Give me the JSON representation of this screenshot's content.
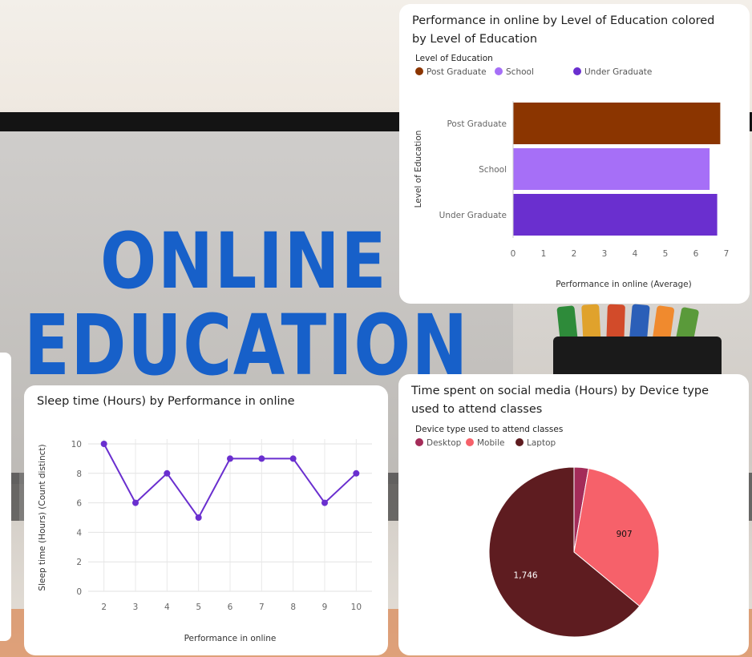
{
  "colors": {
    "post_graduate": "#8b3500",
    "school": "#a66ff7",
    "under_graduate": "#6a2fcf",
    "line": "#6a2fcf",
    "desktop": "#a42c59",
    "mobile": "#f6616a",
    "laptop": "#5e1c20"
  },
  "background": {
    "line1": "ONLINE",
    "line2": "EDUCATION"
  },
  "chart_data": [
    {
      "type": "bar",
      "orientation": "horizontal",
      "title": "Performance in online by Level of Education colored by Level of Education",
      "legend_title": "Level of Education",
      "legend_placement": "top-left",
      "categories": [
        "Post Graduate",
        "School",
        "Under Graduate"
      ],
      "values": [
        6.8,
        6.45,
        6.7
      ],
      "xlabel": "Performance in online (Average)",
      "ylabel": "Level of Education",
      "xlim": [
        0,
        7
      ],
      "xticks": [
        "0",
        "1",
        "2",
        "3",
        "4",
        "5",
        "6",
        "7"
      ],
      "grid": false
    },
    {
      "type": "line",
      "title": "Sleep time (Hours) by Performance in online",
      "x": [
        2,
        3,
        4,
        5,
        6,
        7,
        8,
        9,
        10
      ],
      "y": [
        10,
        6,
        8,
        5,
        9,
        9,
        9,
        6,
        8
      ],
      "xlabel": "Performance in online",
      "ylabel": "Sleep time (Hours) (Count distinct)",
      "ylim": [
        0,
        10
      ],
      "yticks": [
        "0",
        "2",
        "4",
        "6",
        "8",
        "10"
      ],
      "xticks": [
        "2",
        "3",
        "4",
        "5",
        "6",
        "7",
        "8",
        "9",
        "10"
      ],
      "grid": true
    },
    {
      "type": "pie",
      "title": "Time spent on social media (Hours) by Device type used to attend classes",
      "legend_title": "Device type used to attend classes",
      "legend_placement": "top-left",
      "labels": [
        "Desktop",
        "Mobile",
        "Laptop"
      ],
      "values": [
        75,
        907,
        1746
      ],
      "data_labels": [
        "",
        "907",
        "1,746"
      ]
    }
  ]
}
